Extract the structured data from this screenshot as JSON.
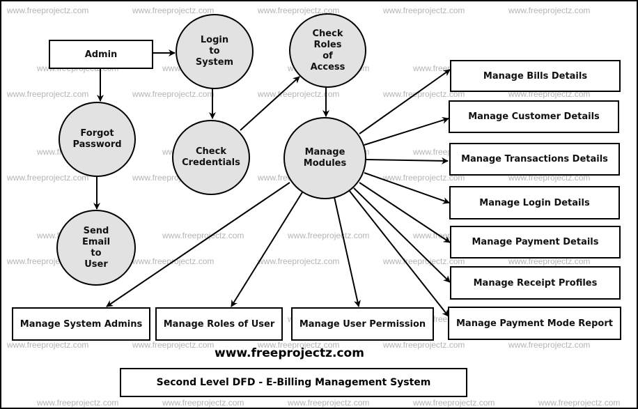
{
  "diagram": {
    "title": "Second Level DFD - E-Billing Management System",
    "site": "www.freeprojectz.com",
    "watermark": "www.freeprojectz.com",
    "external_entity": {
      "label": "Admin"
    },
    "processes": {
      "login": {
        "label": "Login\nto\nSystem"
      },
      "check_credentials": {
        "label": "Check\nCredentials"
      },
      "check_roles": {
        "label": "Check\nRoles\nof\nAccess"
      },
      "manage_modules": {
        "label": "Manage\nModules"
      },
      "forgot_password": {
        "label": "Forgot\nPassword"
      },
      "send_email": {
        "label": "Send\nEmail\nto\nUser"
      }
    },
    "data_stores": {
      "bills": "Manage Bills Details",
      "customer": "Manage Customer Details",
      "transactions": "Manage Transactions Details",
      "login": "Manage Login Details",
      "payment": "Manage Payment Details",
      "receipt": "Manage Receipt Profiles",
      "payment_mode": "Manage Payment Mode Report",
      "system_admins": "Manage System Admins",
      "roles": "Manage Roles of User",
      "permission": "Manage User Permission"
    },
    "flows": [
      {
        "from": "Admin",
        "to": "Login to System"
      },
      {
        "from": "Admin",
        "to": "Forgot Password"
      },
      {
        "from": "Forgot Password",
        "to": "Send Email to User"
      },
      {
        "from": "Login to System",
        "to": "Check Credentials"
      },
      {
        "from": "Check Credentials",
        "to": "Check Roles of Access"
      },
      {
        "from": "Check Roles of Access",
        "to": "Manage Modules"
      },
      {
        "from": "Manage Modules",
        "to": "Manage Bills Details"
      },
      {
        "from": "Manage Modules",
        "to": "Manage Customer Details"
      },
      {
        "from": "Manage Modules",
        "to": "Manage Transactions Details"
      },
      {
        "from": "Manage Modules",
        "to": "Manage Login Details"
      },
      {
        "from": "Manage Modules",
        "to": "Manage Payment Details"
      },
      {
        "from": "Manage Modules",
        "to": "Manage Receipt Profiles"
      },
      {
        "from": "Manage Modules",
        "to": "Manage Payment Mode Report"
      },
      {
        "from": "Manage Modules",
        "to": "Manage System Admins"
      },
      {
        "from": "Manage Modules",
        "to": "Manage Roles of User"
      },
      {
        "from": "Manage Modules",
        "to": "Manage User Permission"
      }
    ]
  }
}
